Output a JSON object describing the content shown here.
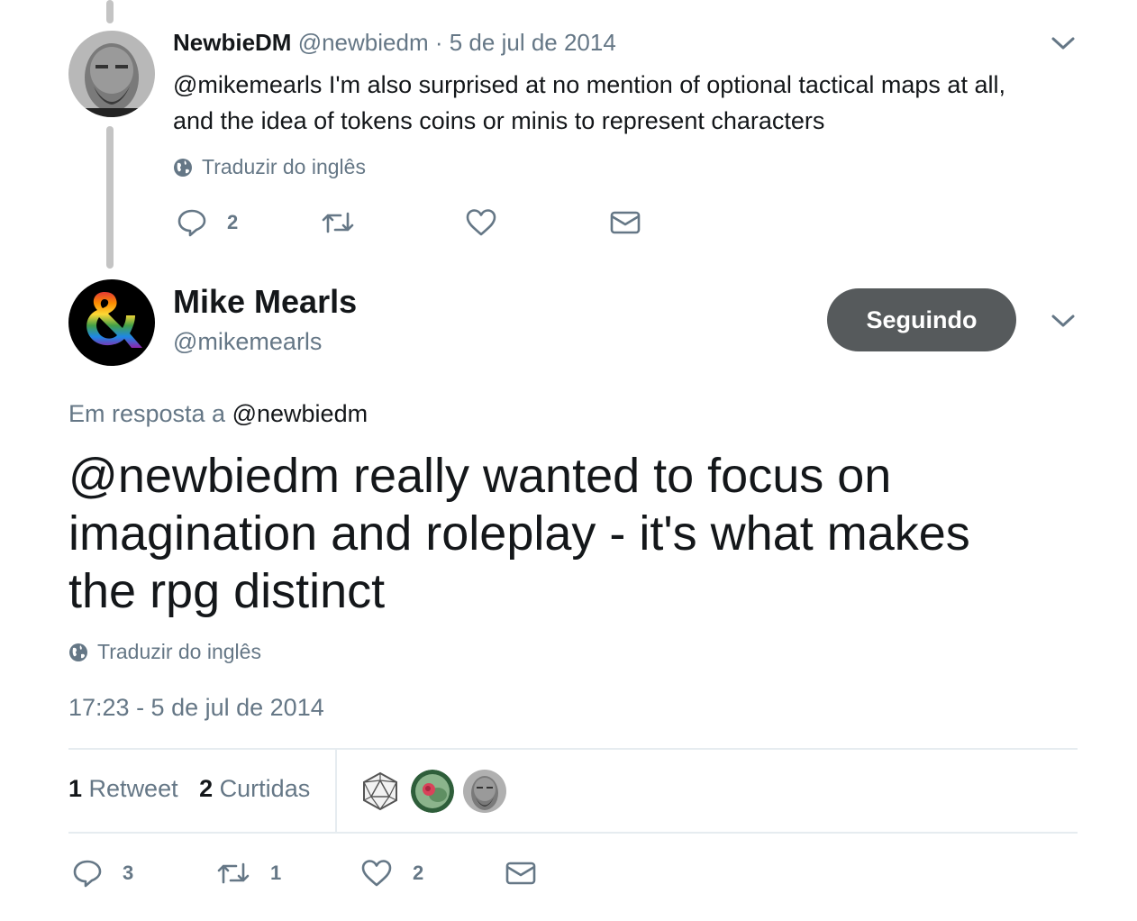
{
  "parent_tweet": {
    "name": "NewbieDM",
    "handle": "@newbiedm",
    "separator": "·",
    "date": "5 de jul de 2014",
    "text_line1": "@mikemearls I'm also surprised at no mention of optional tactical maps at all,",
    "text_line2": "and the idea of tokens coins or minis to represent characters",
    "translate": "Traduzir do inglês",
    "reply_count": "2"
  },
  "main_tweet": {
    "name": "Mike Mearls",
    "handle": "@mikemearls",
    "follow_label": "Seguindo",
    "in_reply_prefix": "Em resposta a",
    "in_reply_handle": "@newbiedm",
    "text_line1": "@newbiedm really wanted to focus on",
    "text_line2": "imagination and roleplay - it's what makes",
    "text_line3": "the rpg distinct",
    "translate": "Traduzir do inglês",
    "timestamp": "17:23 - 5 de jul de 2014",
    "retweets_num": "1",
    "retweets_label": "Retweet",
    "likes_num": "2",
    "likes_label": "Curtidas",
    "reply_count": "3",
    "retweet_count": "1",
    "like_count": "2"
  },
  "colors": {
    "muted": "#657786",
    "text": "#14171a",
    "follow_button": "#565a5c",
    "thread_line": "#c4c4c4"
  },
  "icons": [
    "chevron-down-icon",
    "globe-icon",
    "reply-icon",
    "retweet-icon",
    "heart-icon",
    "mail-icon"
  ]
}
